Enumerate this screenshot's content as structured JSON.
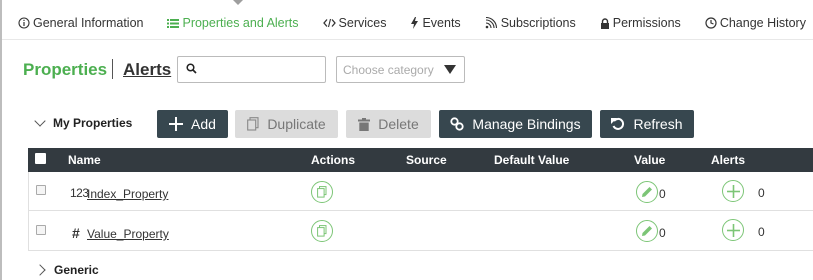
{
  "tabs": [
    {
      "label": "General Information",
      "icon": "info-circle-icon",
      "active": false
    },
    {
      "label": "Properties and Alerts",
      "icon": "list-icon",
      "active": true
    },
    {
      "label": "Services",
      "icon": "code-icon",
      "active": false
    },
    {
      "label": "Events",
      "icon": "lightning-icon",
      "active": false
    },
    {
      "label": "Subscriptions",
      "icon": "signal-icon",
      "active": false
    },
    {
      "label": "Permissions",
      "icon": "lock-icon",
      "active": false
    },
    {
      "label": "Change History",
      "icon": "clock-icon",
      "active": false
    }
  ],
  "header": {
    "properties_label": "Properties",
    "alerts_label": "Alerts",
    "search_placeholder": "",
    "category_placeholder": "Choose category"
  },
  "toolbar": {
    "section_label": "My Properties",
    "add_label": "Add",
    "duplicate_label": "Duplicate",
    "delete_label": "Delete",
    "manage_bindings_label": "Manage Bindings",
    "refresh_label": "Refresh"
  },
  "table": {
    "columns": [
      "Name",
      "Actions",
      "Source",
      "Default Value",
      "Value",
      "Alerts"
    ],
    "rows": [
      {
        "type": "123",
        "name": "Index_Property",
        "value": "0",
        "alerts": "0"
      },
      {
        "type": "#",
        "name": "Value_Property",
        "value": "0",
        "alerts": "0"
      }
    ]
  },
  "sections": {
    "generic_label": "Generic"
  },
  "colors": {
    "accent_green": "#4caf50",
    "dark_button": "#37474f",
    "header_bg": "#333a40",
    "disabled_button": "#dcdcdc"
  }
}
